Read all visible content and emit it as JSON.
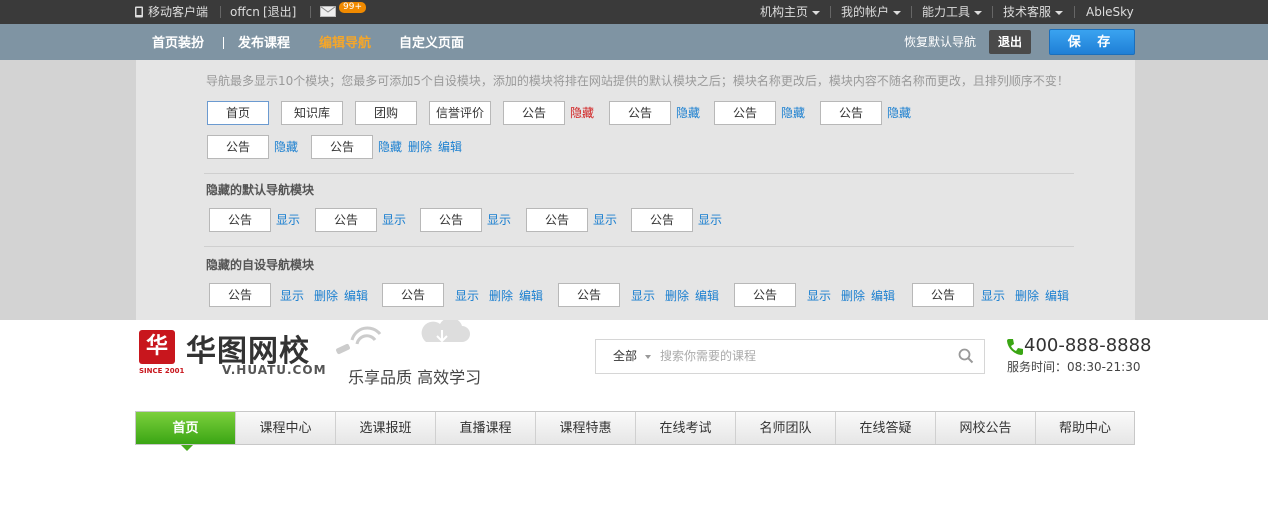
{
  "topbar": {
    "mobile_client": "移动客户端",
    "username": "offcn",
    "logout": "[退出]",
    "mail_badge": "99+",
    "menus": [
      "机构主页",
      "我的帐户",
      "能力工具",
      "技术客服"
    ],
    "brand": "AbleSky"
  },
  "navbar": {
    "items": [
      "首页装扮",
      "发布课程",
      "编辑导航",
      "自定义页面"
    ],
    "active_index": 2,
    "restore": "恢复默认导航",
    "logout": "退出",
    "save": "保 存"
  },
  "editor": {
    "hint": "导航最多显示10个模块；您最多可添加5个自设模块，添加的模块将排在网站提供的默认模块之后；模块名称更改后，模块内容不随名称而更改，且排列顺序不变！",
    "active_modules": [
      {
        "label": "首页"
      },
      {
        "label": "知识库"
      },
      {
        "label": "团购"
      },
      {
        "label": "信誉评价"
      },
      {
        "label": "公告",
        "hide": "隐藏"
      },
      {
        "label": "公告",
        "hide": "隐藏"
      },
      {
        "label": "公告",
        "hide": "隐藏"
      },
      {
        "label": "公告",
        "hide": "隐藏"
      },
      {
        "label": "公告",
        "hide": "隐藏"
      },
      {
        "label": "公告",
        "hide": "隐藏",
        "delete": "删除",
        "edit": "编辑"
      }
    ],
    "hidden_default_title": "隐藏的默认导航模块",
    "hidden_default": [
      {
        "label": "公告",
        "show": "显示"
      },
      {
        "label": "公告",
        "show": "显示"
      },
      {
        "label": "公告",
        "show": "显示"
      },
      {
        "label": "公告",
        "show": "显示"
      },
      {
        "label": "公告",
        "show": "显示"
      }
    ],
    "hidden_custom_title": "隐藏的自设导航模块",
    "hidden_custom": [
      {
        "label": "公告",
        "show": "显示",
        "delete": "删除",
        "edit": "编辑"
      },
      {
        "label": "公告",
        "show": "显示",
        "delete": "删除",
        "edit": "编辑"
      },
      {
        "label": "公告",
        "show": "显示",
        "delete": "删除",
        "edit": "编辑"
      },
      {
        "label": "公告",
        "show": "显示",
        "delete": "删除",
        "edit": "编辑"
      },
      {
        "label": "公告",
        "show": "显示",
        "delete": "删除",
        "edit": "编辑"
      }
    ]
  },
  "site": {
    "logo_mark": "华",
    "since": "SINCE 2001",
    "name": "华图网校",
    "url": "V.HUATU.COM",
    "slogan": "乐享品质  高效学习",
    "search_scope": "全部",
    "search_placeholder": "搜索你需要的课程",
    "phone": "400-888-8888",
    "hours": "服务时间：08:30-21:30",
    "nav": [
      "首页",
      "课程中心",
      "选课报班",
      "直播课程",
      "课程特惠",
      "在线考试",
      "名师团队",
      "在线答疑",
      "网校公告",
      "帮助中心"
    ]
  },
  "colors": {
    "topbar": "#3a3a3a",
    "navbar": "#7f94a3",
    "active_nav": "#f4a62a",
    "save_button": "#2a8fe3",
    "link": "#1a7fd0",
    "hide_active": "#d12020",
    "brand_red": "#c8161d",
    "home_green": "#45ab1c"
  }
}
